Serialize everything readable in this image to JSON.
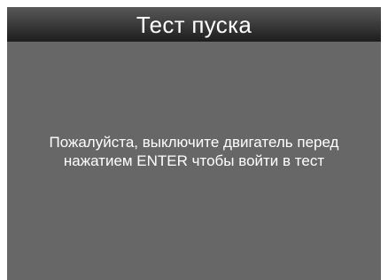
{
  "header": {
    "title": "Тест пуска"
  },
  "main": {
    "message_line1": "Пожалуйста, выключите двигатель перед",
    "message_line2": "нажатием ENTER чтобы войти в тест"
  },
  "colors": {
    "screen_background": "#676767",
    "title_bar_top": "#585858",
    "title_bar_bottom": "#1d1d1d",
    "text": "#ffffff"
  }
}
